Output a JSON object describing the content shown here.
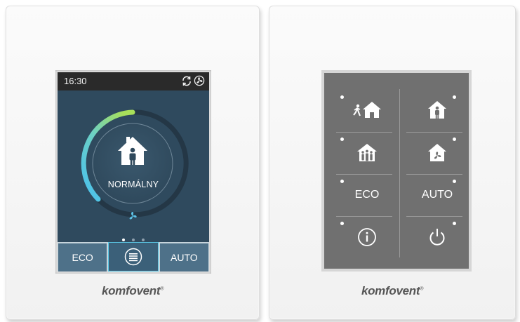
{
  "left_panel": {
    "topbar": {
      "time": "16:30",
      "icons": [
        "sync-icon",
        "fan-icon"
      ]
    },
    "gauge": {
      "mode_label": "NORMÁLNY",
      "center_icon": "person-in-house-icon",
      "fan_icon": "fan-icon",
      "accent_color": "#5dc3e8",
      "track_color": "#243746"
    },
    "page_dots": {
      "count": 3,
      "active": 0
    },
    "bottombar": {
      "left_label": "ECO",
      "center_icon": "menu-icon",
      "right_label": "AUTO"
    },
    "brand": "komfovent"
  },
  "right_panel": {
    "buttons": [
      {
        "id": "away",
        "icon": "person-walking-away-icon"
      },
      {
        "id": "normal",
        "icon": "person-in-house-icon"
      },
      {
        "id": "intensive",
        "icon": "group-in-house-icon"
      },
      {
        "id": "boost",
        "icon": "fan-in-house-icon"
      },
      {
        "id": "eco",
        "label": "ECO"
      },
      {
        "id": "auto",
        "label": "AUTO"
      },
      {
        "id": "info",
        "icon": "info-icon"
      },
      {
        "id": "power",
        "icon": "power-icon"
      }
    ],
    "brand": "komfovent"
  }
}
